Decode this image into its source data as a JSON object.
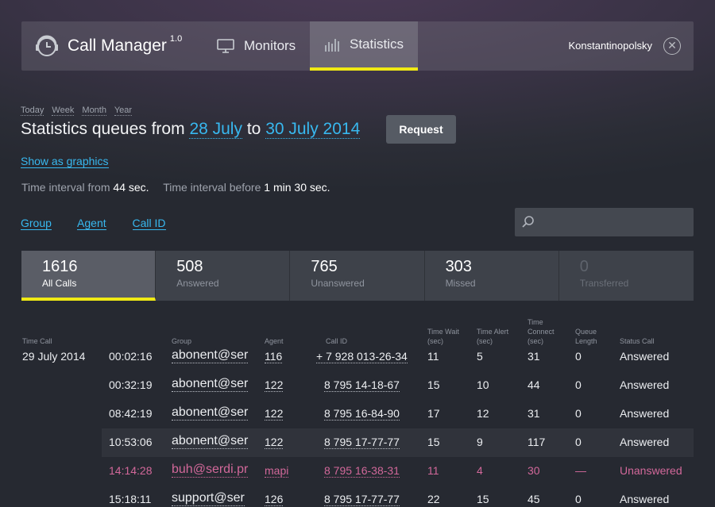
{
  "app": {
    "title": "Call Manager",
    "version": "1.0"
  },
  "nav": {
    "monitors": "Monitors",
    "statistics": "Statistics"
  },
  "user": {
    "name": "Konstantinopolsky",
    "close": "✕"
  },
  "periods": [
    "Today",
    "Week",
    "Month",
    "Year"
  ],
  "heading": {
    "prefix": "Statistics queues from",
    "from": "28 July",
    "to_word": "to",
    "to": "30 July 2014"
  },
  "request_label": "Request",
  "show_graphics": "Show as graphics",
  "interval": {
    "from_label": "Time interval from",
    "from_value": "44 sec.",
    "before_label": "Time interval before",
    "before_value": "1 min 30 sec."
  },
  "filters": [
    "Group",
    "Agent",
    "Call ID"
  ],
  "search": {
    "placeholder": "",
    "value": ""
  },
  "stats": [
    {
      "num": "1616",
      "label": "All Calls"
    },
    {
      "num": "508",
      "label": "Answered"
    },
    {
      "num": "765",
      "label": "Unanswered"
    },
    {
      "num": "303",
      "label": "Missed"
    },
    {
      "num": "0",
      "label": "Transferred"
    }
  ],
  "table": {
    "headers": {
      "time_call": "Time Call",
      "group": "Group",
      "agent": "Agent",
      "call_id": "Call ID",
      "time_wait": [
        "Time Wait",
        "(sec)"
      ],
      "time_alert": [
        "Time Alert",
        "(sec)"
      ],
      "time_connect": [
        "Time",
        "Connect",
        "(sec)"
      ],
      "queue_length": [
        "Queue",
        "Length"
      ],
      "status": "Status Call"
    },
    "date": "29 July 2014",
    "rows": [
      {
        "time": "00:02:16",
        "group": "abonent@ser",
        "agent": "116",
        "call_id": "+ 7 928 013-26-34",
        "wait": "11",
        "alert": "5",
        "connect": "31",
        "queue": "0",
        "status": "Answered"
      },
      {
        "time": "00:32:19",
        "group": "abonent@ser",
        "agent": "122",
        "call_id": "8 795 14-18-67",
        "wait": "15",
        "alert": "10",
        "connect": "44",
        "queue": "0",
        "status": "Answered"
      },
      {
        "time": "08:42:19",
        "group": "abonent@ser",
        "agent": "122",
        "call_id": "8 795 16-84-90",
        "wait": "17",
        "alert": "12",
        "connect": "31",
        "queue": "0",
        "status": "Answered"
      },
      {
        "time": "10:53:06",
        "group": "abonent@ser",
        "agent": "122",
        "call_id": "8 795 17-77-77",
        "wait": "15",
        "alert": "9",
        "connect": "117",
        "queue": "0",
        "status": "Answered"
      },
      {
        "time": "14:14:28",
        "group": "buh@serdi.pr",
        "agent": "mapi",
        "call_id": "8 795 16-38-31",
        "wait": "11",
        "alert": "4",
        "connect": "30",
        "queue": "—",
        "status": "Unanswered"
      },
      {
        "time": "15:18:11",
        "group": "support@ser",
        "agent": "126",
        "call_id": "8 795 17-77-77",
        "wait": "22",
        "alert": "15",
        "connect": "45",
        "queue": "0",
        "status": "Answered"
      }
    ]
  },
  "colors": {
    "accent": "#38b8ef",
    "highlight": "#f0ea14",
    "unanswered": "#d2689a"
  }
}
